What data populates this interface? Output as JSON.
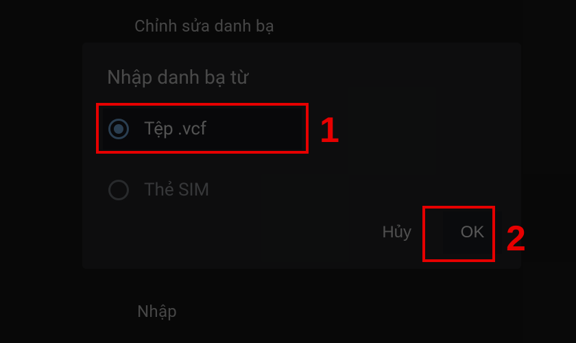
{
  "background_menu": {
    "edit_contacts": "Chỉnh sửa danh bạ",
    "import": "Nhập"
  },
  "dialog": {
    "title": "Nhập danh bạ từ",
    "options": [
      {
        "label": "Tệp .vcf",
        "selected": true
      },
      {
        "label": "Thẻ SIM",
        "selected": false
      }
    ],
    "actions": {
      "cancel": "Hủy",
      "ok": "OK"
    }
  },
  "annotations": {
    "step1": "1",
    "step2": "2"
  },
  "colors": {
    "highlight": "#e60000",
    "radio_selected": "#6ea2d6",
    "dialog_bg": "#232426"
  }
}
